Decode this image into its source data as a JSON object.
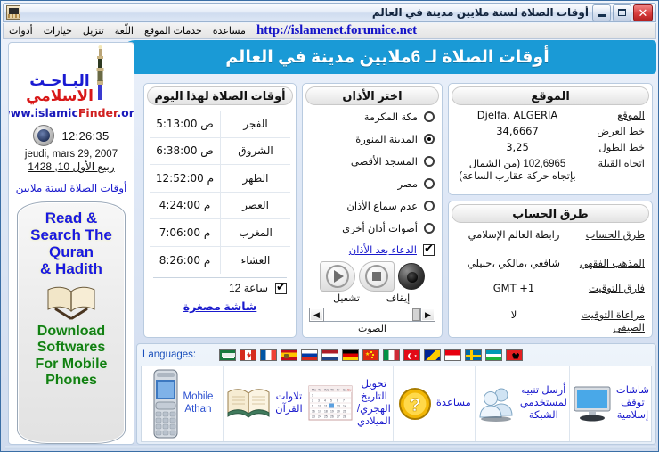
{
  "window": {
    "title": "أوقات الصلاة لستة ملايين مدينة في العالم",
    "icon": "kaaba-icon",
    "minimize_label": "_",
    "maximize_label": "□",
    "close_label": "✕"
  },
  "menu": {
    "items": [
      {
        "label": "أدوات",
        "name": "menu-tools"
      },
      {
        "label": "خيارات",
        "name": "menu-options"
      },
      {
        "label": "تنزيل",
        "name": "menu-download"
      },
      {
        "label": "اللّغة",
        "name": "menu-language"
      },
      {
        "label": "خدمات الموقع",
        "name": "menu-site-services"
      },
      {
        "label": "مساعدة",
        "name": "menu-help"
      }
    ],
    "site_url": "http://islamenet.forumice.net"
  },
  "banner": {
    "text": "أوقات الصلاة لـ 6ملايين مدينة في العالم",
    "color": "#1a9ad6"
  },
  "sidebar": {
    "logo_line1": "البـاحـث",
    "logo_line2": "الاسلامي",
    "site_a": "www.islamic",
    "site_b": "Finder",
    "site_c": ".org",
    "clock": "12:26:35",
    "gregorian_date": "jeudi, mars 29, 2007",
    "hijri_date": "ربيع الأول 10, 1428",
    "link": "أوقات الصلاة لستة ملايين",
    "promo_top": "Read &\nSearch The\nQuran\n& Hadith",
    "promo_bottom": "Download\nSoftwares\nFor Mobile\nPhones"
  },
  "prayer": {
    "title": "أوقات الصلاة لهذا اليوم",
    "rows": [
      {
        "name": "الفجر",
        "time": "5:13:00",
        "meridiem": "ص"
      },
      {
        "name": "الشروق",
        "time": "6:38:00",
        "meridiem": "ص"
      },
      {
        "name": "الظهر",
        "time": "12:52:00",
        "meridiem": "م"
      },
      {
        "name": "العصر",
        "time": "4:24:00",
        "meridiem": "م"
      },
      {
        "name": "المغرب",
        "time": "7:06:00",
        "meridiem": "م"
      },
      {
        "name": "العشاء",
        "time": "8:26:00",
        "meridiem": "م"
      }
    ],
    "hour_format_label": "ساعة 12",
    "hour_format_checked": true,
    "mini_screen_link": "شاشة مصغرة"
  },
  "athan": {
    "title": "اختر الأذان",
    "options": [
      {
        "label": "مكة المكرمة",
        "selected": false
      },
      {
        "label": "المدينة المنورة",
        "selected": true
      },
      {
        "label": "المسجد الأقصى",
        "selected": false
      },
      {
        "label": "مصر",
        "selected": false
      },
      {
        "label": "عدم سماع الأذان",
        "selected": false
      },
      {
        "label": "أصوات أذان أخرى",
        "selected": false
      }
    ],
    "dua_label": "الدعاء بعد الأذان",
    "dua_checked": true,
    "stop_label": "إيقاف",
    "play_label": "تشغيل",
    "volume_label": "الصوت"
  },
  "location": {
    "title": "الموقع",
    "rows": [
      {
        "key": "الموقع",
        "value": "Djelfa, ALGERIA",
        "ltr": true
      },
      {
        "key": "خط العرض",
        "value": "34,6667",
        "ltr": true
      },
      {
        "key": "خط الطول",
        "value": "3,25",
        "ltr": true
      },
      {
        "key": "اتجاه القبلة",
        "value": "102,6965 (من الشمال بإتجاه حركة عقارب الساعة)",
        "ltr": false
      }
    ]
  },
  "calculation": {
    "title": "طرق الحساب",
    "rows": [
      {
        "key": "طرق الحساب",
        "value": "رابطة العالم الإسلامي"
      },
      {
        "key": "المذهب الفقهي",
        "value": "شافعي ،مالكي ،حنبلي"
      },
      {
        "key": "فارق التوقيت",
        "value": "GMT +1"
      },
      {
        "key": "مراعاة التوقيت الصيفي",
        "value": "لا"
      }
    ]
  },
  "bottom": {
    "languages_label": "Languages:",
    "flags": [
      {
        "name": "flag-saudi-arabia",
        "title": "Saudi Arabia"
      },
      {
        "name": "flag-canada",
        "title": "Canada"
      },
      {
        "name": "flag-france",
        "title": "France"
      },
      {
        "name": "flag-spain",
        "title": "Spain"
      },
      {
        "name": "flag-russia",
        "title": "Russia"
      },
      {
        "name": "flag-netherlands",
        "title": "Netherlands"
      },
      {
        "name": "flag-germany",
        "title": "Germany"
      },
      {
        "name": "flag-china",
        "title": "China"
      },
      {
        "name": "flag-italy",
        "title": "Italy"
      },
      {
        "name": "flag-turkey",
        "title": "Turkey"
      },
      {
        "name": "flag-bosnia",
        "title": "Bosnia"
      },
      {
        "name": "flag-indonesia",
        "title": "Indonesia"
      },
      {
        "name": "flag-sweden",
        "title": "Sweden"
      },
      {
        "name": "flag-uzbekistan",
        "title": "Uzbekistan"
      },
      {
        "name": "flag-albania",
        "title": "Albania"
      }
    ],
    "buttons": [
      {
        "name": "mobile-athan-button",
        "label": "Mobile\nAthan",
        "icon": "mobile-phone-icon",
        "ltr": true
      },
      {
        "name": "quran-recitations-button",
        "label": "تلاوات القرآن",
        "icon": "open-book-icon",
        "ltr": false
      },
      {
        "name": "date-converter-button",
        "label": "تحويل التاريخ\nالهجري/الميلادي",
        "icon": "calendar-icon",
        "ltr": false
      },
      {
        "name": "help-button",
        "label": "مساعدة",
        "icon": "question-mark-icon",
        "ltr": false
      },
      {
        "name": "network-notify-button",
        "label": "أرسل تنبيه\nلمستخدمي الشبكة",
        "icon": "users-group-icon",
        "ltr": false
      },
      {
        "name": "islamic-screensaver-button",
        "label": "شاشات توقف\nإسلامية",
        "icon": "monitor-icon",
        "ltr": false
      }
    ]
  }
}
